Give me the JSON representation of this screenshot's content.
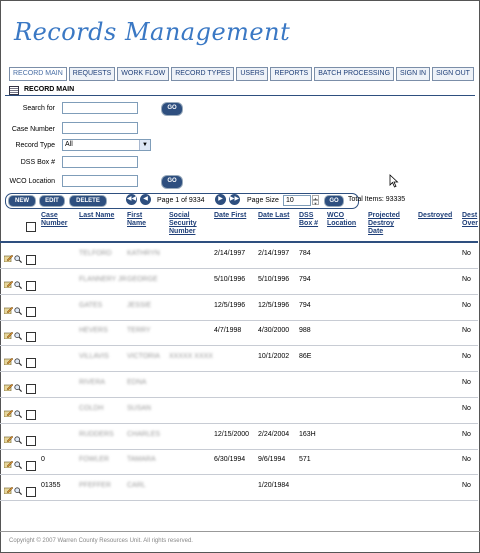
{
  "app": {
    "title": "Records Management"
  },
  "nav": [
    {
      "label": "RECORD MAIN",
      "active": true
    },
    {
      "label": "REQUESTS"
    },
    {
      "label": "WORK FLOW"
    },
    {
      "label": "RECORD TYPES"
    },
    {
      "label": "USERS"
    },
    {
      "label": "REPORTS"
    },
    {
      "label": "BATCH PROCESSING"
    },
    {
      "label": "SIGN IN"
    },
    {
      "label": "SIGN OUT"
    }
  ],
  "section": {
    "title": "RECORD MAIN"
  },
  "search": {
    "search_for_label": "Search for",
    "go_label": "GO",
    "case_number_label": "Case Number",
    "record_type_label": "Record Type",
    "record_type_value": "All",
    "dss_box_label": "DSS Box #",
    "wco_location_label": "WCO Location"
  },
  "toolbar": {
    "new_label": "NEW",
    "edit_label": "EDIT",
    "delete_label": "DELETE",
    "first_icon": "first-page-icon",
    "prev_icon": "prev-page-icon",
    "next_icon": "next-page-icon",
    "last_icon": "last-page-icon",
    "page_text": "Page 1 of 9334",
    "page_size_label": "Page Size",
    "page_size_value": "10",
    "go_label": "GO",
    "total_text": "Total Items: 93335"
  },
  "table": {
    "headers": {
      "case_number": [
        "Case",
        "Number"
      ],
      "last_name": "Last Name",
      "first_name": [
        "First",
        "Name"
      ],
      "ssn": [
        "Social",
        "Security",
        "Number"
      ],
      "date_first": "Date First",
      "date_last": "Date Last",
      "dss_box": [
        "DSS",
        "Box #"
      ],
      "wco_location": [
        "WCO",
        "Location"
      ],
      "projected": [
        "Projected",
        "Destroy",
        "Date"
      ],
      "destroyed": "Destroyed",
      "dest_override": [
        "Dest",
        "Over"
      ]
    },
    "rows": [
      {
        "case": "",
        "last": "TELFORD",
        "first": "KATHRYN",
        "ssn": "",
        "date_first": "2/14/1997",
        "date_last": "2/14/1997",
        "box": "784",
        "dest": "No"
      },
      {
        "case": "",
        "last": "FLANNERY JR",
        "first": "GEORGE",
        "ssn": "",
        "date_first": "5/10/1996",
        "date_last": "5/10/1996",
        "box": "794",
        "dest": "No"
      },
      {
        "case": "",
        "last": "GATES",
        "first": "JESSIE",
        "ssn": "",
        "date_first": "12/5/1996",
        "date_last": "12/5/1996",
        "box": "794",
        "dest": "No"
      },
      {
        "case": "",
        "last": "HEVERS",
        "first": "TERRY",
        "ssn": "",
        "date_first": "4/7/1998",
        "date_last": "4/30/2000",
        "box": "988",
        "dest": "No"
      },
      {
        "case": "",
        "last": "VILLAVIS",
        "first": "VICTORIA",
        "ssn": "XXXXX XXXX",
        "date_first": "",
        "date_last": "10/1/2002",
        "box": "86E",
        "dest": "No"
      },
      {
        "case": "",
        "last": "RIVERA",
        "first": "EDNA",
        "ssn": "",
        "date_first": "",
        "date_last": "",
        "box": "",
        "dest": "No"
      },
      {
        "case": "",
        "last": "COLDH",
        "first": "SUSAN",
        "ssn": "",
        "date_first": "",
        "date_last": "",
        "box": "",
        "dest": "No"
      },
      {
        "case": "",
        "last": "RUDDERS",
        "first": "CHARLES",
        "ssn": "",
        "date_first": "12/15/2000",
        "date_last": "2/24/2004",
        "box": "163H",
        "dest": "No"
      },
      {
        "case": "0",
        "last": "FOWLER",
        "first": "TAMARA",
        "ssn": "",
        "date_first": "6/30/1994",
        "date_last": "9/6/1994",
        "box": "571",
        "dest": "No"
      },
      {
        "case": "01355",
        "last": "PFEFFER",
        "first": "CARL",
        "ssn": "",
        "date_first": "",
        "date_last": "1/20/1984",
        "box": "",
        "dest": "No"
      }
    ]
  },
  "footer": {
    "text": "Copyright © 2007 Warren County Resources Unit. All rights reserved."
  }
}
